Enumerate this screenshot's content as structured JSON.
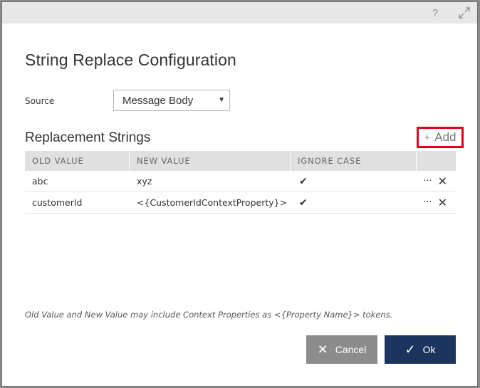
{
  "titlebar": {
    "help_icon": "?",
    "expand_icon": "expand-icon"
  },
  "dialog": {
    "title": "String Replace Configuration"
  },
  "source": {
    "label": "Source",
    "selected": "Message Body",
    "caret": "▼"
  },
  "replacements": {
    "title": "Replacement Strings",
    "add_icon": "+",
    "add_label": "Add",
    "columns": [
      "OLD VALUE",
      "NEW VALUE",
      "IGNORE CASE",
      ""
    ],
    "rows": [
      {
        "old": "abc",
        "new": "xyz",
        "ignore_case": "✔"
      },
      {
        "old": "customerId",
        "new": "<{CustomerIdContextProperty}>",
        "ignore_case": "✔"
      }
    ],
    "more_icon": "···",
    "remove_icon": "✕"
  },
  "note": "Old Value and New Value may include Context Properties as <{Property Name}> tokens.",
  "buttons": {
    "cancel_icon": "✕",
    "cancel_label": "Cancel",
    "ok_icon": "✓",
    "ok_label": "Ok"
  },
  "colors": {
    "primary": "#1b355e",
    "secondary": "#8c8c8c",
    "highlight": "#e0001b"
  }
}
